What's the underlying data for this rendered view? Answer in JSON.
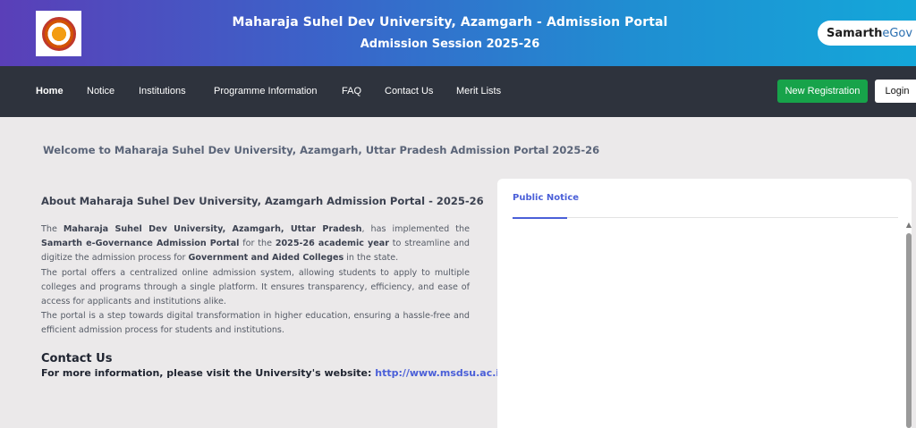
{
  "header": {
    "title": "Maharaja Suhel Dev University, Azamgarh - Admission Portal",
    "session": "Admission Session 2025-26",
    "badge_main": "Samarth",
    "badge_sub": "eGov"
  },
  "nav": {
    "items": [
      "Home",
      "Notice",
      "Institutions",
      "Programme Information",
      "FAQ",
      "Contact Us",
      "Merit Lists"
    ],
    "register_label": "New Registration",
    "login_label": "Login"
  },
  "welcome": "Welcome to Maharaja Suhel Dev University, Azamgarh, Uttar Pradesh Admission Portal 2025-26",
  "about": {
    "title": "About Maharaja Suhel Dev University, Azamgarh Admission Portal - 2025-26",
    "p1_a": "The ",
    "p1_b": "Maharaja Suhel Dev University, Azamgarh, Uttar Pradesh",
    "p1_c": ", has implemented the ",
    "p1_d": "Samarth e-Governance Admission Portal",
    "p1_e": " for the ",
    "p1_f": "2025-26 academic year",
    "p1_g": " to streamline and digitize the admission process for ",
    "p1_h": "Government and Aided Colleges",
    "p1_i": " in the state.",
    "p2": "The portal offers a centralized online admission system, allowing students to apply to multiple colleges and programs through a single platform. It ensures transparency, efficiency, and ease of access for applicants and institutions alike.",
    "p3": "The portal is a step towards digital transformation in higher education, ensuring a hassle-free and efficient admission process for students and institutions."
  },
  "contact": {
    "title": "Contact Us",
    "text": "For more information, please visit the University's website: ",
    "link": "http://www.msdsu.ac.in"
  },
  "notice": {
    "tab_label": "Public Notice"
  }
}
